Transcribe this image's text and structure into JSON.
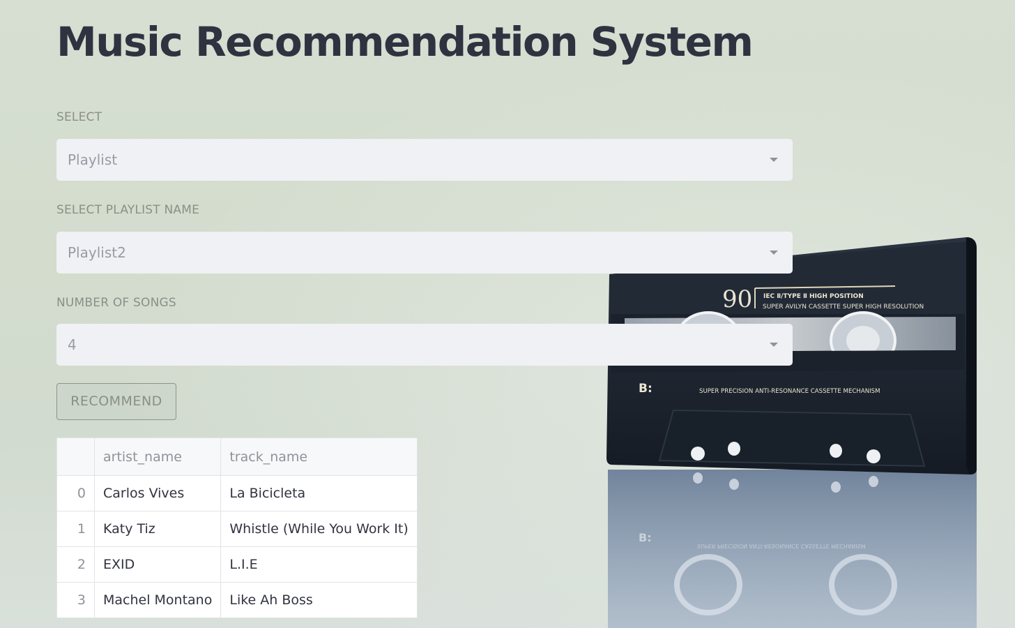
{
  "app": {
    "title": "Music Recommendation System"
  },
  "form": {
    "select": {
      "label": "SELECT",
      "value": "Playlist"
    },
    "playlist": {
      "label": "SELECT PLAYLIST NAME",
      "value": "Playlist2"
    },
    "num_songs": {
      "label": "NUMBER OF SONGS",
      "value": "4"
    },
    "recommend_label": "RECOMMEND"
  },
  "results": {
    "columns": [
      "",
      "artist_name",
      "track_name"
    ],
    "rows": [
      {
        "index": "0",
        "artist_name": "Carlos Vives",
        "track_name": "La Bicicleta"
      },
      {
        "index": "1",
        "artist_name": "Katy Tiz",
        "track_name": "Whistle (While You Work It)"
      },
      {
        "index": "2",
        "artist_name": "EXID",
        "track_name": "L.I.E"
      },
      {
        "index": "3",
        "artist_name": "Machel Montano",
        "track_name": "Like Ah Boss"
      }
    ]
  },
  "cassette": {
    "tape_length": "90",
    "type_line": "IEC Ⅱ/TYPE Ⅱ  HIGH POSITION",
    "brand_line": "SUPER AVILYN CASSETTE SUPER HIGH RESOLUTION",
    "side": "B:",
    "mechanism_line": "SUPER PRECISION ANTI-RESONANCE CASSETTE MECHANISM"
  },
  "colors": {
    "background": "#d4ddd0",
    "title": "#2f3340",
    "label": "#8a8f88",
    "input_bg": "#f0f1f4",
    "cassette_body": "#1e2530"
  }
}
